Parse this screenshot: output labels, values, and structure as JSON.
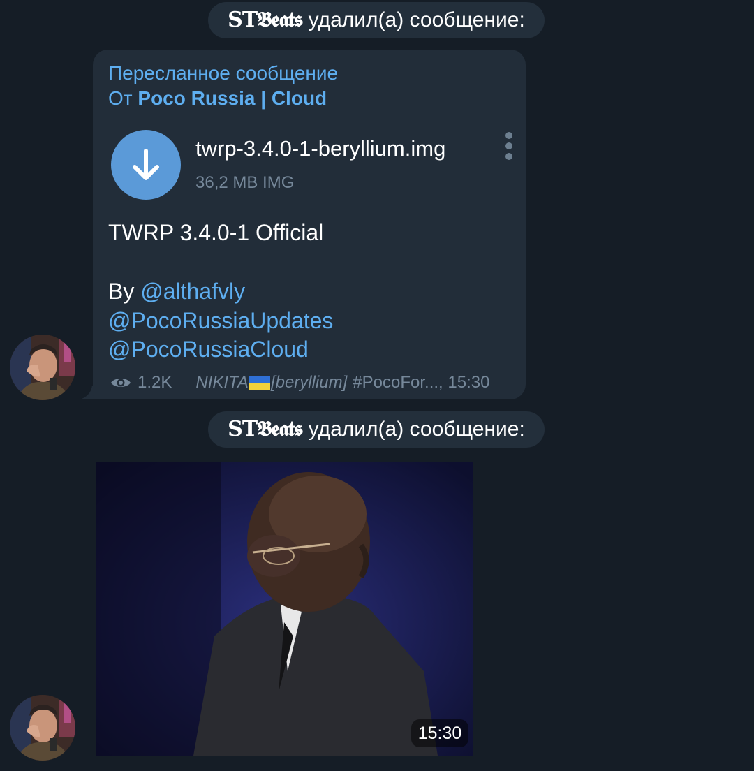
{
  "service_messages": [
    {
      "username": "ST𝕭𝖊𝖆𝖙𝖘",
      "action": "удалил(а) сообщение:"
    },
    {
      "username": "ST𝕭𝖊𝖆𝖙𝖘",
      "action": "удалил(а) сообщение:"
    }
  ],
  "message": {
    "forwarded_label": "Пересланное сообщение",
    "forwarded_from_prefix": "От",
    "forwarded_from_channel": "Poco Russia | Cloud",
    "file": {
      "name": "twrp-3.4.0-1-beryllium.img",
      "size": "36,2 MB IMG",
      "icon": "download-icon"
    },
    "caption": {
      "title": "TWRP 3.4.0-1 Official",
      "by_prefix": "By",
      "mention": "@althafvly",
      "channel_updates": "@PocoRussiaUpdates",
      "channel_cloud": "@PocoRussiaCloud"
    },
    "views": "1.2K",
    "signature_name": "NIKITA",
    "signature_tag": "[beryllium]",
    "signature_hashtag": "#PocoFor...",
    "time": "15:30"
  },
  "media_message": {
    "type": "gif",
    "time": "15:30"
  },
  "colors": {
    "background": "#151d26",
    "bubble": "#222d39",
    "accent": "#5eaef0",
    "download_button": "#5b9ad8",
    "secondary_text": "#76889a"
  }
}
